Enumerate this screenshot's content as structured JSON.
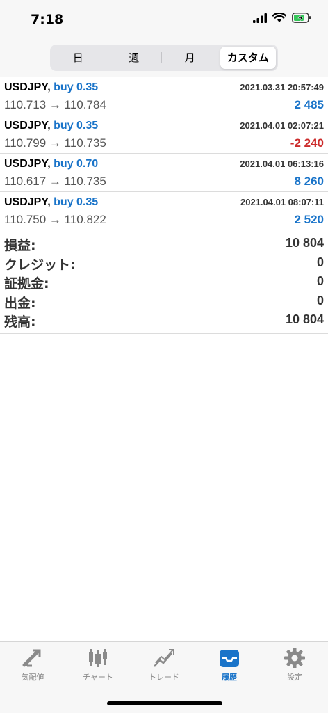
{
  "status": {
    "time": "7:18"
  },
  "segments": [
    {
      "label": "日",
      "active": false
    },
    {
      "label": "週",
      "active": false
    },
    {
      "label": "月",
      "active": false
    },
    {
      "label": "カスタム",
      "active": true
    }
  ],
  "trades": [
    {
      "symbol": "USDJPY,",
      "side": "buy 0.35",
      "date": "2021.03.31 20:57:49",
      "prices": "110.713 → 110.784",
      "profit": "2 485",
      "sign": "pos"
    },
    {
      "symbol": "USDJPY,",
      "side": "buy 0.35",
      "date": "2021.04.01 02:07:21",
      "prices": "110.799 → 110.735",
      "profit": "-2 240",
      "sign": "neg"
    },
    {
      "symbol": "USDJPY,",
      "side": "buy 0.70",
      "date": "2021.04.01 06:13:16",
      "prices": "110.617 → 110.735",
      "profit": "8 260",
      "sign": "pos"
    },
    {
      "symbol": "USDJPY,",
      "side": "buy 0.35",
      "date": "2021.04.01 08:07:11",
      "prices": "110.750 → 110.822",
      "profit": "2 520",
      "sign": "pos"
    }
  ],
  "summary": [
    {
      "label": "損益:",
      "value": "10 804"
    },
    {
      "label": "クレジット:",
      "value": "0"
    },
    {
      "label": "証拠金:",
      "value": "0"
    },
    {
      "label": "出金:",
      "value": "0"
    },
    {
      "label": "残高:",
      "value": "10 804"
    }
  ],
  "tabs": [
    {
      "label": "気配値",
      "icon": "quotes-icon",
      "active": false
    },
    {
      "label": "チャート",
      "icon": "candlestick-chart-icon",
      "active": false
    },
    {
      "label": "トレード",
      "icon": "trade-icon",
      "active": false
    },
    {
      "label": "履歴",
      "icon": "history-inbox-icon",
      "active": true
    },
    {
      "label": "設定",
      "icon": "settings-gear-icon",
      "active": false
    }
  ],
  "colors": {
    "accent": "#1a74c9",
    "negative": "#cc2b2b",
    "inactive_tab": "#8a8a8a"
  }
}
